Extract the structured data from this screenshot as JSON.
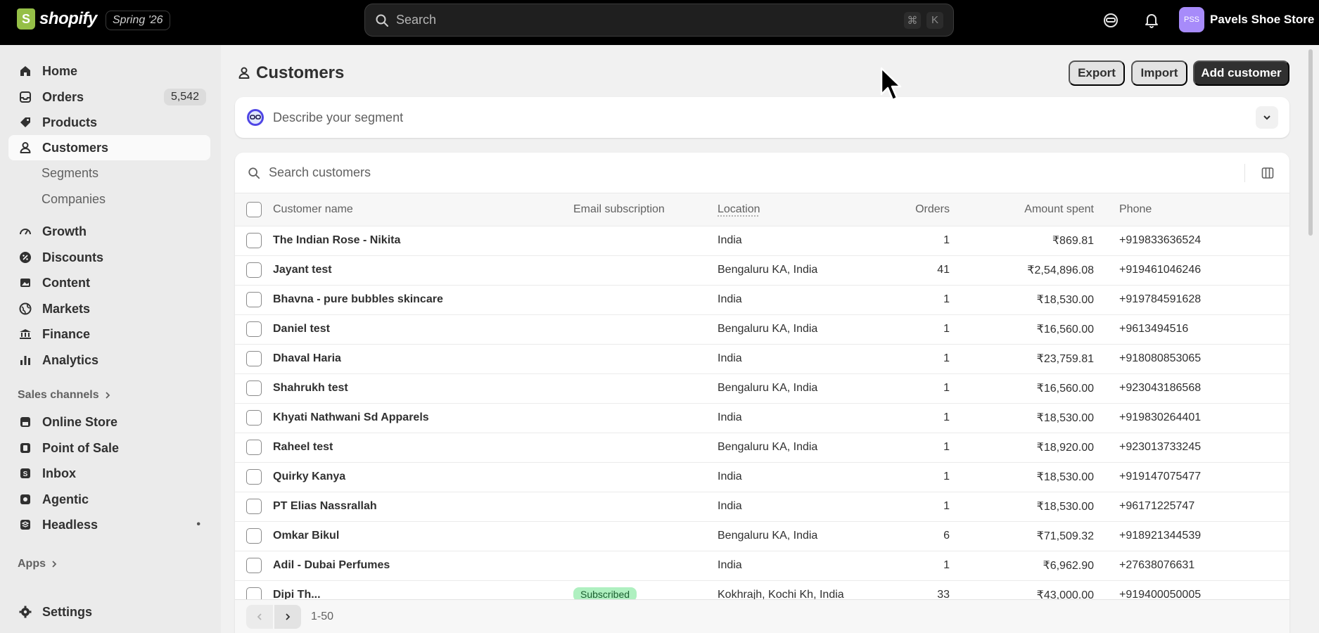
{
  "topbar": {
    "brand": "shopify",
    "edition": "Spring '26",
    "search_placeholder": "Search",
    "shortcut_keys": [
      "⌘",
      "K"
    ],
    "store_initials": "PSS",
    "store_name": "Pavels Shoe Store",
    "avatar_color": "#a78bfa"
  },
  "sidebar": {
    "items": [
      {
        "label": "Home",
        "icon": "home-icon"
      },
      {
        "label": "Orders",
        "icon": "inbox-icon",
        "badge": "5,542"
      },
      {
        "label": "Products",
        "icon": "tag-icon"
      },
      {
        "label": "Customers",
        "icon": "person-icon",
        "active": true
      },
      {
        "label": "Segments"
      },
      {
        "label": "Companies"
      },
      {
        "label": "Growth",
        "icon": "gauge-icon"
      },
      {
        "label": "Discounts",
        "icon": "discount-icon"
      },
      {
        "label": "Content",
        "icon": "image-icon"
      },
      {
        "label": "Markets",
        "icon": "globe-icon"
      },
      {
        "label": "Finance",
        "icon": "bank-icon"
      },
      {
        "label": "Analytics",
        "icon": "chart-icon"
      }
    ],
    "sales_channels_title": "Sales channels",
    "channels": [
      {
        "label": "Online Store"
      },
      {
        "label": "Point of Sale"
      },
      {
        "label": "Inbox"
      },
      {
        "label": "Agentic"
      },
      {
        "label": "Headless",
        "dot": "•"
      }
    ],
    "apps_title": "Apps",
    "settings_label": "Settings"
  },
  "main": {
    "title": "Customers",
    "export_label": "Export",
    "import_label": "Import",
    "add_label": "Add customer",
    "segment_placeholder": "Describe your segment",
    "search_placeholder": "Search customers",
    "columns": [
      "Customer name",
      "Email subscription",
      "Location",
      "Orders",
      "Amount spent",
      "Phone"
    ],
    "rows": [
      {
        "name": "The Indian Rose - Nikita",
        "email": "",
        "location": "India",
        "orders": "1",
        "amount": "₹869.81",
        "phone": "+919833636524"
      },
      {
        "name": "Jayant test",
        "email": "",
        "location": "Bengaluru KA, India",
        "orders": "41",
        "amount": "₹2,54,896.08",
        "phone": "+919461046246"
      },
      {
        "name": "Bhavna - pure bubbles skincare",
        "email": "",
        "location": "India",
        "orders": "1",
        "amount": "₹18,530.00",
        "phone": "+919784591628"
      },
      {
        "name": "Daniel test",
        "email": "",
        "location": "Bengaluru KA, India",
        "orders": "1",
        "amount": "₹16,560.00",
        "phone": "+9613494516"
      },
      {
        "name": "Dhaval Haria",
        "email": "",
        "location": "India",
        "orders": "1",
        "amount": "₹23,759.81",
        "phone": "+918080853065"
      },
      {
        "name": "Shahrukh test",
        "email": "",
        "location": "Bengaluru KA, India",
        "orders": "1",
        "amount": "₹16,560.00",
        "phone": "+923043186568"
      },
      {
        "name": "Khyati Nathwani Sd Apparels",
        "email": "",
        "location": "India",
        "orders": "1",
        "amount": "₹18,530.00",
        "phone": "+919830264401"
      },
      {
        "name": "Raheel test",
        "email": "",
        "location": "Bengaluru KA, India",
        "orders": "1",
        "amount": "₹18,920.00",
        "phone": "+923013733245"
      },
      {
        "name": "Quirky Kanya",
        "email": "",
        "location": "India",
        "orders": "1",
        "amount": "₹18,530.00",
        "phone": "+919147075477"
      },
      {
        "name": "PT Elias Nassrallah",
        "email": "",
        "location": "India",
        "orders": "1",
        "amount": "₹18,530.00",
        "phone": "+96171225747"
      },
      {
        "name": "Omkar Bikul",
        "email": "",
        "location": "Bengaluru KA, India",
        "orders": "6",
        "amount": "₹71,509.32",
        "phone": "+918921344539"
      },
      {
        "name": "Adil - Dubai Perfumes",
        "email": "",
        "location": "India",
        "orders": "1",
        "amount": "₹6,962.90",
        "phone": "+27638076631"
      }
    ],
    "partial_row": {
      "name": "Dipi Th...",
      "email": "Subscribed",
      "location": "Kokhrajh, Kochi Kh, India",
      "orders": "33",
      "amount": "₹43,000.00",
      "phone": "+919400050005"
    },
    "pagination_label": "1-50"
  }
}
